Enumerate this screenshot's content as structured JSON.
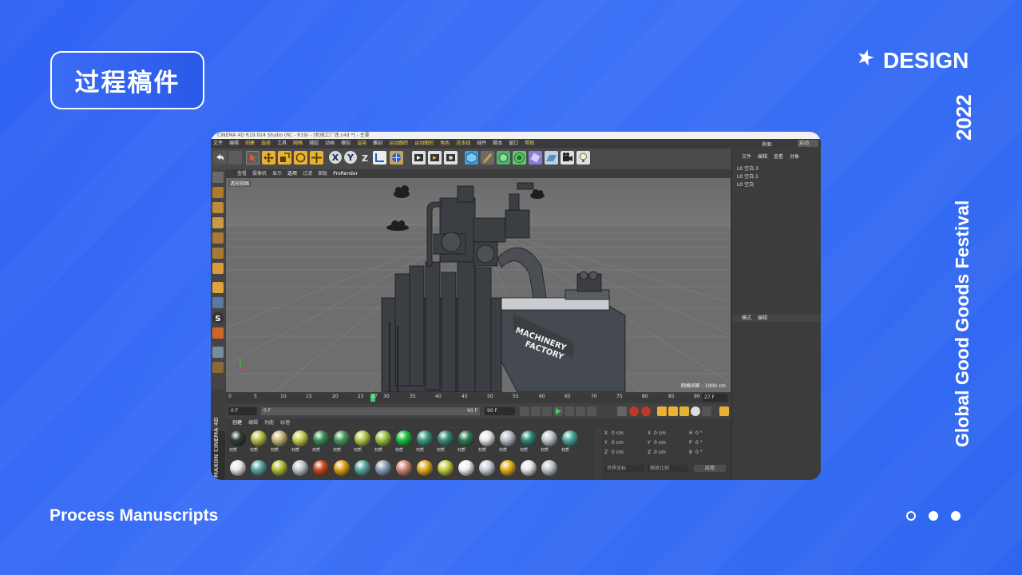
{
  "slide": {
    "title_badge": "过程稿件",
    "design_label": "DESIGN",
    "year": "2022",
    "festival": "Global Good Goods Festival",
    "process_label": "Process Manuscripts",
    "pagination": {
      "total": 3,
      "current": 1
    }
  },
  "app": {
    "title": "CINEMA 4D R19.024 Studio (RC - R19) - [机械工厂改.c4d *] - 主要",
    "menu": [
      "文件",
      "编辑",
      "创建",
      "选择",
      "工具",
      "网格",
      "捕捉",
      "动画",
      "模拟",
      "渲染",
      "雕刻",
      "运动跟踪",
      "运动图形",
      "角色",
      "流水线",
      "插件",
      "脚本",
      "窗口",
      "帮助"
    ],
    "menu_highlight": [
      "创建",
      "选择",
      "网格",
      "渲染",
      "运动跟踪",
      "运动图形",
      "角色",
      "流水线",
      "帮助"
    ],
    "layout_label": "界面:",
    "layout_value": "启动",
    "view_menu": [
      "查看",
      "摄像机",
      "显示",
      "选项",
      "过滤",
      "面板",
      "ProRender"
    ],
    "viewport_label": "透视视图",
    "grid_spacing": "网格间距 : 1000 cm",
    "scene_text_line1": "MACHINERY",
    "scene_text_line2": "FACTORY",
    "timeline_ticks": [
      "0",
      "5",
      "10",
      "15",
      "20",
      "25",
      "27",
      "30",
      "35",
      "40",
      "45",
      "50",
      "55",
      "60",
      "65",
      "70",
      "75",
      "80",
      "85",
      "90"
    ],
    "current_frame_field": "27 F",
    "frame_start": "0 F",
    "frame_mid": "0 F",
    "frame_range_end": "90 F",
    "frame_end": "90 F",
    "material_menu": [
      "创建",
      "编辑",
      "功能",
      "纹理"
    ],
    "material_label": "材质",
    "brand_text": "MAXON CINEMA 4D",
    "object_manager_menu": [
      "文件",
      "编辑",
      "查看",
      "对象"
    ],
    "objects": [
      "空白.3",
      "空白.1",
      "空白"
    ],
    "attribute_menu": [
      "模式",
      "编辑"
    ],
    "coords": {
      "rows": [
        {
          "a": "X",
          "av": "0 cm",
          "b": "X",
          "bv": "0 cm",
          "c": "H",
          "cv": "0 °"
        },
        {
          "a": "Y",
          "av": "0 cm",
          "b": "Y",
          "bv": "0 cm",
          "c": "P",
          "cv": "0 °"
        },
        {
          "a": "Z",
          "av": "0 cm",
          "b": "Z",
          "bv": "0 cm",
          "c": "B",
          "cv": "0 °"
        }
      ],
      "dropdown1": "世界坐标",
      "dropdown2": "缩放比例",
      "apply": "应用"
    }
  },
  "colors": {
    "background": "#3469f4",
    "accent_green": "#3fcf6a"
  }
}
